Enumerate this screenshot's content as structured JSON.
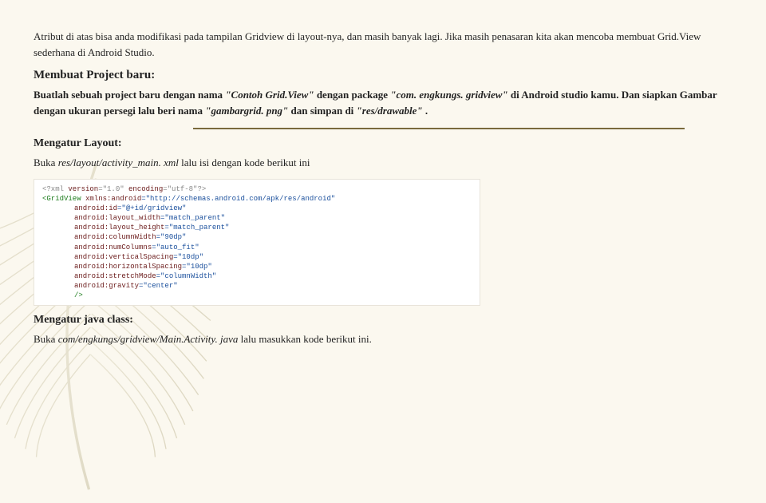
{
  "intro": "Atribut di atas bisa anda modifikasi pada tampilan Gridview di layout-nya, dan masih banyak lagi. Jika masih penasaran kita akan mencoba membuat Grid.View sederhana di Android Studio.",
  "section1": {
    "heading": "Membuat Project baru:",
    "body_parts": {
      "t1": "Buatlah sebuah project baru dengan nama ",
      "q1": "\"Contoh Grid.View\"",
      "t2": " dengan package ",
      "q2": "\"com. engkungs. gridview\"",
      "t3": " di Android studio kamu. Dan siapkan Gambar dengan ukuran persegi lalu beri nama ",
      "q3": "\"gambargrid. png\"",
      "t4": " dan simpan di ",
      "q4": "\"res/drawable\"",
      "t5": " ."
    }
  },
  "section2": {
    "heading": "Mengatur Layout:",
    "body_parts": {
      "t1": "Buka ",
      "path": "res/layout/activity_main. xml",
      "t2": " lalu isi dengan kode berikut ini"
    },
    "code": {
      "l0a": "<?xml ",
      "l0b": "version",
      "l0c": "=\"1.0\" ",
      "l0d": "encoding",
      "l0e": "=\"utf-8\"?>",
      "l1a": "<GridView ",
      "l1b": "xmlns:android",
      "l1c": "=\"http://schemas.android.com/apk/res/android\"",
      "l2a": "android:id",
      "l2b": "=\"@+id/gridview\"",
      "l3a": "android:layout_width",
      "l3b": "=\"match_parent\"",
      "l4a": "android:layout_height",
      "l4b": "=\"match_parent\"",
      "l5a": "android:columnWidth",
      "l5b": "=\"90dp\"",
      "l6a": "android:numColumns",
      "l6b": "=\"auto_fit\"",
      "l7a": "android:verticalSpacing",
      "l7b": "=\"10dp\"",
      "l8a": "android:horizontalSpacing",
      "l8b": "=\"10dp\"",
      "l9a": "android:stretchMode",
      "l9b": "=\"columnWidth\"",
      "l10a": "android:gravity",
      "l10b": "=\"center\"",
      "l11": "/>"
    }
  },
  "section3": {
    "heading": "Mengatur java class:",
    "body_parts": {
      "t1": "Buka ",
      "path": "com/engkungs/gridview/Main.Activity. java",
      "t2": " lalu masukkan kode berikut ini."
    }
  }
}
